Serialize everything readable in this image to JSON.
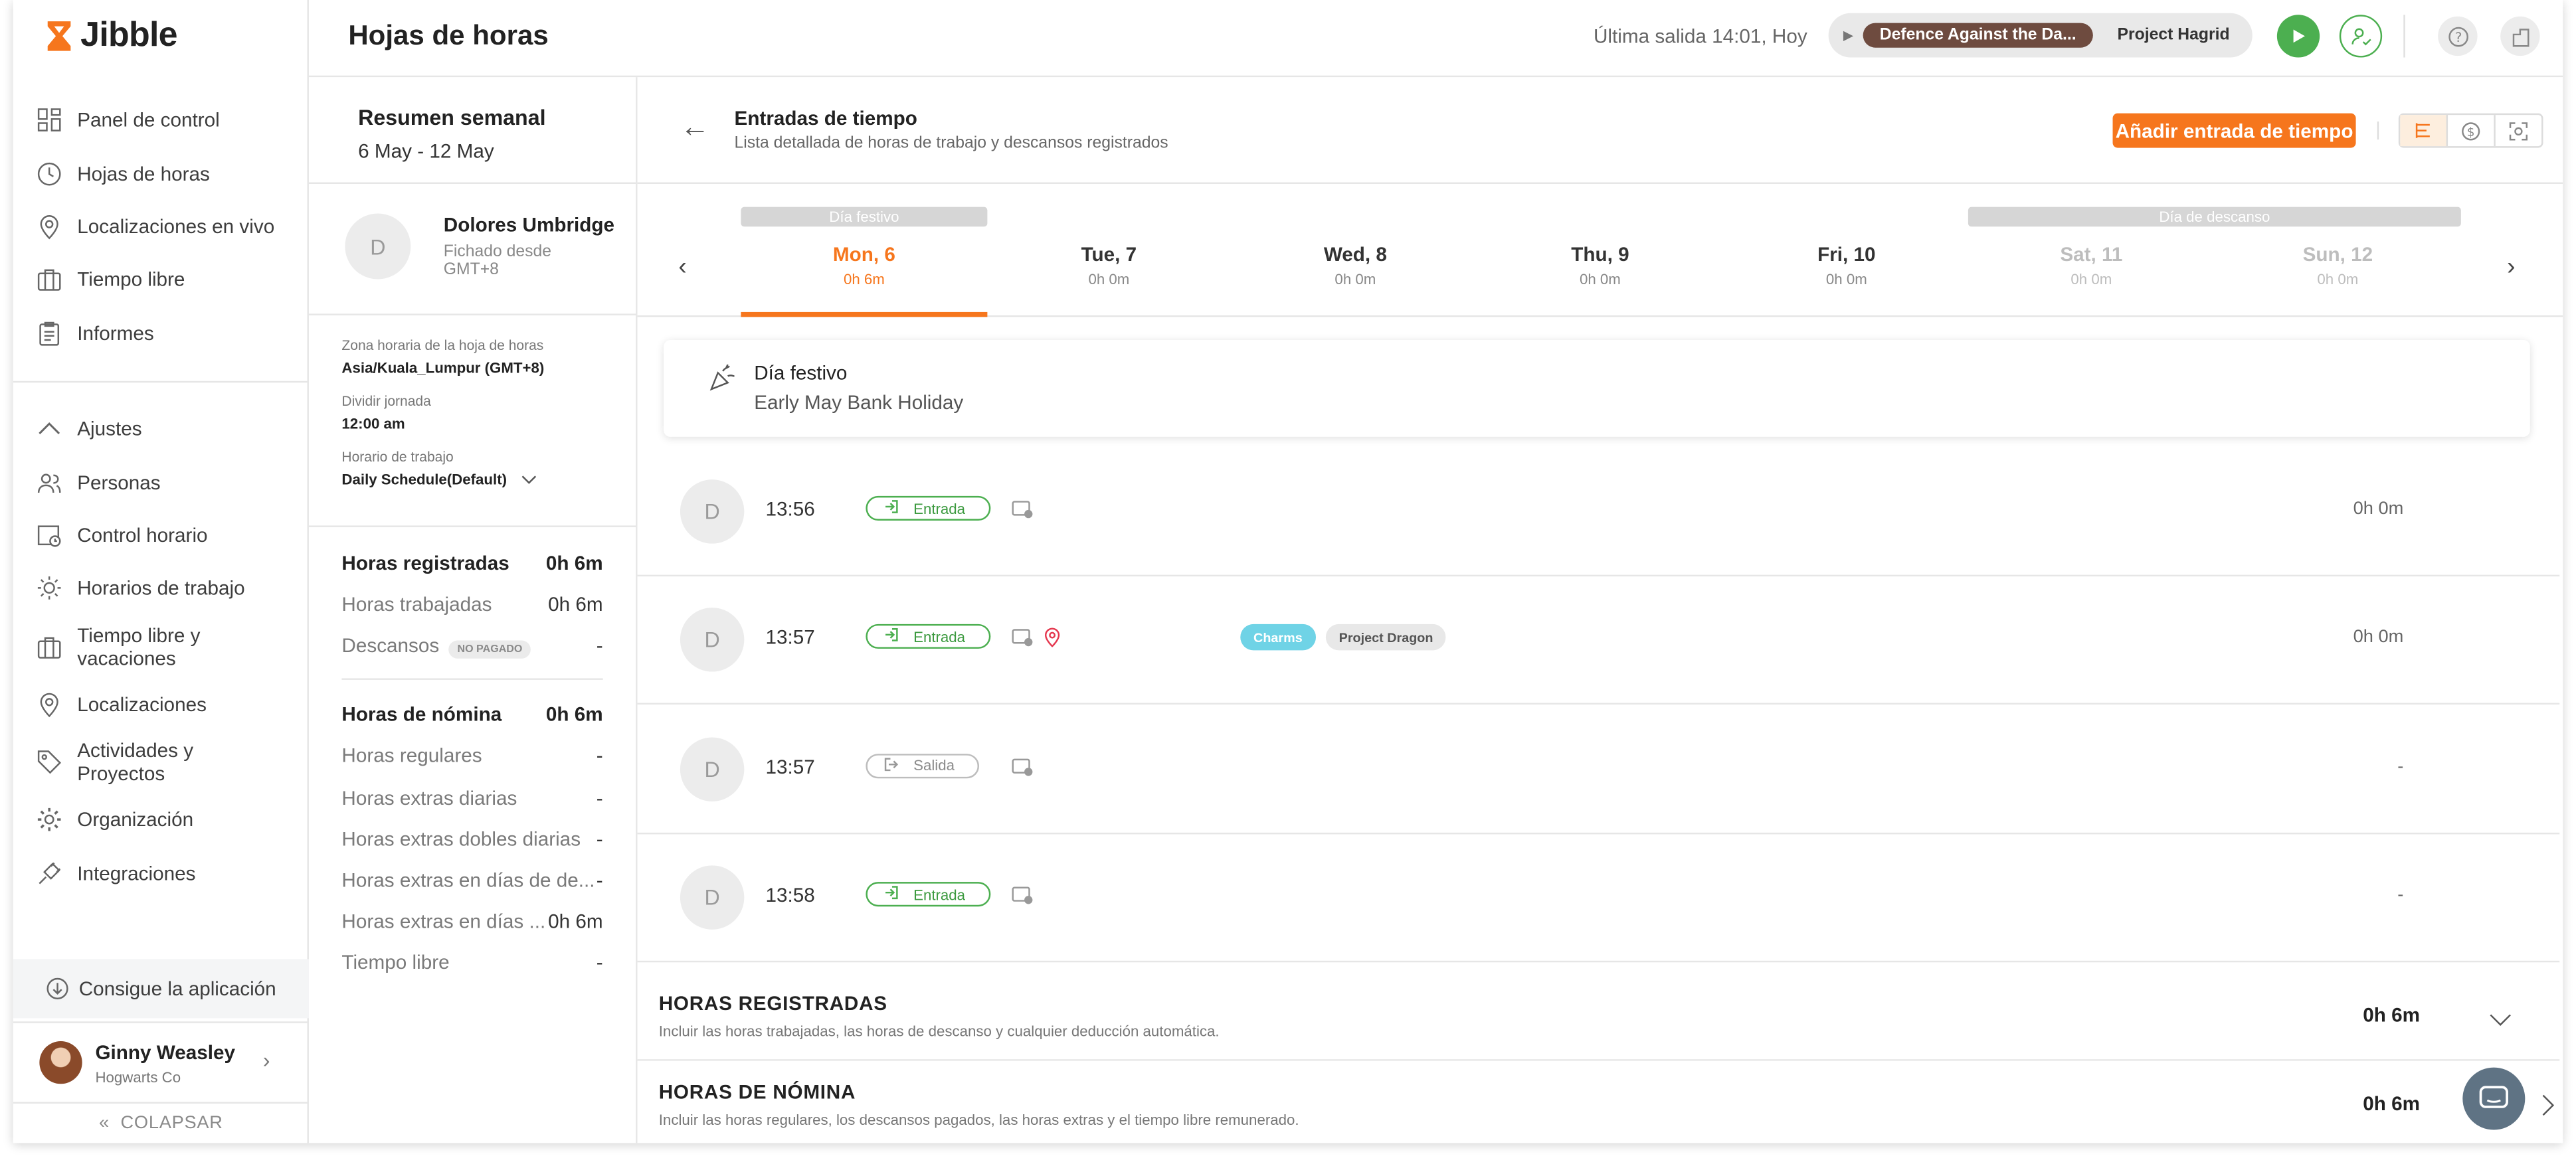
{
  "app": {
    "name": "Jibble"
  },
  "sidebar": {
    "items_top": [
      {
        "label": "Panel de control",
        "icon": "dashboard-icon"
      },
      {
        "label": "Hojas de horas",
        "icon": "clock-icon"
      },
      {
        "label": "Localizaciones en vivo",
        "icon": "location-pin-icon"
      },
      {
        "label": "Tiempo libre",
        "icon": "briefcase-icon"
      },
      {
        "label": "Informes",
        "icon": "clipboard-icon"
      }
    ],
    "items_settings": [
      {
        "label": "Ajustes",
        "icon": "chevron-up-icon"
      },
      {
        "label": "Personas",
        "icon": "people-icon"
      },
      {
        "label": "Control horario",
        "icon": "time-tracking-icon"
      },
      {
        "label": "Horarios de trabajo",
        "icon": "sun-schedule-icon"
      },
      {
        "label": "Tiempo libre y vacaciones",
        "icon": "briefcase-icon"
      },
      {
        "label": "Localizaciones",
        "icon": "location-pin-icon"
      },
      {
        "label": "Actividades y Proyectos",
        "icon": "tag-icon"
      },
      {
        "label": "Organización",
        "icon": "gear-icon"
      },
      {
        "label": "Integraciones",
        "icon": "plug-icon"
      }
    ],
    "get_app": "Consigue la aplicación",
    "user": {
      "name": "Ginny Weasley",
      "org": "Hogwarts Co"
    },
    "collapse": "COLAPSAR"
  },
  "topbar": {
    "title": "Hojas de horas",
    "last_out": "Última salida 14:01, Hoy",
    "activity": "Defence Against the Da...",
    "project": "Project Hagrid"
  },
  "summary": {
    "title": "Resumen semanal",
    "range": "6 May - 12 May",
    "employee": {
      "initial": "D",
      "name": "Dolores Umbridge",
      "since": "Fichado desde GMT+8"
    },
    "tz_label": "Zona horaria de la hoja de horas",
    "tz_value": "Asia/Kuala_Lumpur (GMT+8)",
    "split_label": "Dividir jornada",
    "split_value": "12:00 am",
    "schedule_label": "Horario de trabajo",
    "schedule_value": "Daily Schedule(Default)",
    "tracked": [
      {
        "label": "Horas registradas",
        "value": "0h 6m",
        "bold": true
      },
      {
        "label": "Horas trabajadas",
        "value": "0h 6m"
      },
      {
        "label": "Descansos",
        "value": "-",
        "badge": "NO PAGADO"
      }
    ],
    "payroll": [
      {
        "label": "Horas de nómina",
        "value": "0h 6m",
        "bold": true
      },
      {
        "label": "Horas regulares",
        "value": "-"
      },
      {
        "label": "Horas extras diarias",
        "value": "-"
      },
      {
        "label": "Horas extras dobles diarias",
        "value": "-"
      },
      {
        "label": "Horas extras en días de de...",
        "value": "-"
      },
      {
        "label": "Horas extras en días ...",
        "value": "0h 6m"
      },
      {
        "label": "Tiempo libre",
        "value": "-"
      }
    ]
  },
  "main": {
    "title": "Entradas de tiempo",
    "subtitle": "Lista detallada de horas de trabajo y descansos registrados",
    "add_button": "Añadir entrada de tiempo",
    "tags": {
      "holiday": "Día festivo",
      "rest": "Día de descanso"
    },
    "days": [
      {
        "name": "Mon, 6",
        "hours": "0h 6m",
        "state": "sel"
      },
      {
        "name": "Tue, 7",
        "hours": "0h 0m",
        "state": ""
      },
      {
        "name": "Wed, 8",
        "hours": "0h 0m",
        "state": ""
      },
      {
        "name": "Thu, 9",
        "hours": "0h 0m",
        "state": ""
      },
      {
        "name": "Fri, 10",
        "hours": "0h 0m",
        "state": ""
      },
      {
        "name": "Sat, 11",
        "hours": "0h 0m",
        "state": "off"
      },
      {
        "name": "Sun, 12",
        "hours": "0h 0m",
        "state": "off"
      }
    ],
    "holiday": {
      "title": "Día festivo",
      "name": "Early May Bank Holiday"
    },
    "entries": [
      {
        "initial": "D",
        "time": "13:56",
        "type": "Entrada",
        "kind": "in",
        "pin": false,
        "duration": "0h 0m"
      },
      {
        "initial": "D",
        "time": "13:57",
        "type": "Entrada",
        "kind": "in",
        "pin": true,
        "duration": "0h 0m",
        "activity": "Charms",
        "project": "Project Dragon"
      },
      {
        "initial": "D",
        "time": "13:57",
        "type": "Salida",
        "kind": "out",
        "pin": false,
        "duration": "-"
      },
      {
        "initial": "D",
        "time": "13:58",
        "type": "Entrada",
        "kind": "in",
        "pin": false,
        "duration": "-"
      }
    ],
    "totals": [
      {
        "title": "HORAS REGISTRADAS",
        "desc": "Incluir las horas trabajadas, las horas de descanso y cualquier deducción automática.",
        "value": "0h 6m"
      },
      {
        "title": "HORAS DE NÓMINA",
        "desc": "Incluir las horas regulares, los descansos pagados, las horas extras y el tiempo libre remunerado.",
        "value": "0h 6m"
      }
    ]
  },
  "colors": {
    "accent": "#f6761d",
    "green": "#4caf50",
    "charms": "#6fd3e6",
    "activity": "#6e4b3f"
  }
}
